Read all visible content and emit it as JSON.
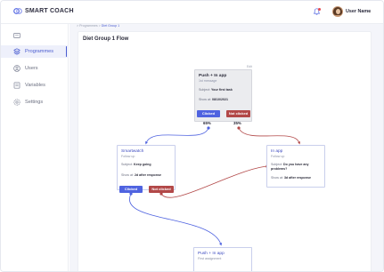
{
  "app": {
    "logo_text": "SMART COACH"
  },
  "header": {
    "user_name": "User Name",
    "user_chevron": "⌄"
  },
  "sidebar": {
    "items": [
      {
        "label": "",
        "icon": "dashboard-icon"
      },
      {
        "label": "Programmes",
        "icon": "programmes-icon",
        "active": true
      },
      {
        "label": "Users",
        "icon": "users-icon"
      },
      {
        "label": "Variables",
        "icon": "variables-icon"
      },
      {
        "label": "Settings",
        "icon": "settings-icon"
      }
    ]
  },
  "breadcrumb": {
    "items": [
      "Programmes",
      "Diet Group 1"
    ],
    "separator": ">"
  },
  "page": {
    "title": "Diet Group 1 Flow"
  },
  "colors": {
    "accent": "#4f63e0",
    "clicked": "#4f63e0",
    "not_clicked": "#b24848"
  },
  "flow": {
    "root": {
      "title": "Push + In app",
      "subtitle": "1st message",
      "subject_label": "Subject:",
      "subject_value": "Your first task",
      "show_label": "Show at:",
      "show_value": "08/10/2021",
      "edit_label": "Edit",
      "clicked_label": "Clicked",
      "not_clicked_label": "Not clicked",
      "clicked_pct": "65%",
      "not_clicked_pct": "35%"
    },
    "smartwatch": {
      "title": "Smartwatch",
      "subtitle": "Follow up",
      "subject_label": "Subject:",
      "subject_value": "Keep going",
      "show_label": "Show at:",
      "show_value": "2d after response",
      "clicked_label": "Clicked",
      "not_clicked_label": "Not clicked"
    },
    "inapp": {
      "title": "In app",
      "subtitle": "Follow up",
      "subject_label": "Subject:",
      "subject_value_1": "Do you have any",
      "subject_value_2": "problems?",
      "show_label": "Show at:",
      "show_value": "3d after response"
    },
    "bottom": {
      "title": "Push + In app",
      "subtitle": "First assignment"
    }
  }
}
